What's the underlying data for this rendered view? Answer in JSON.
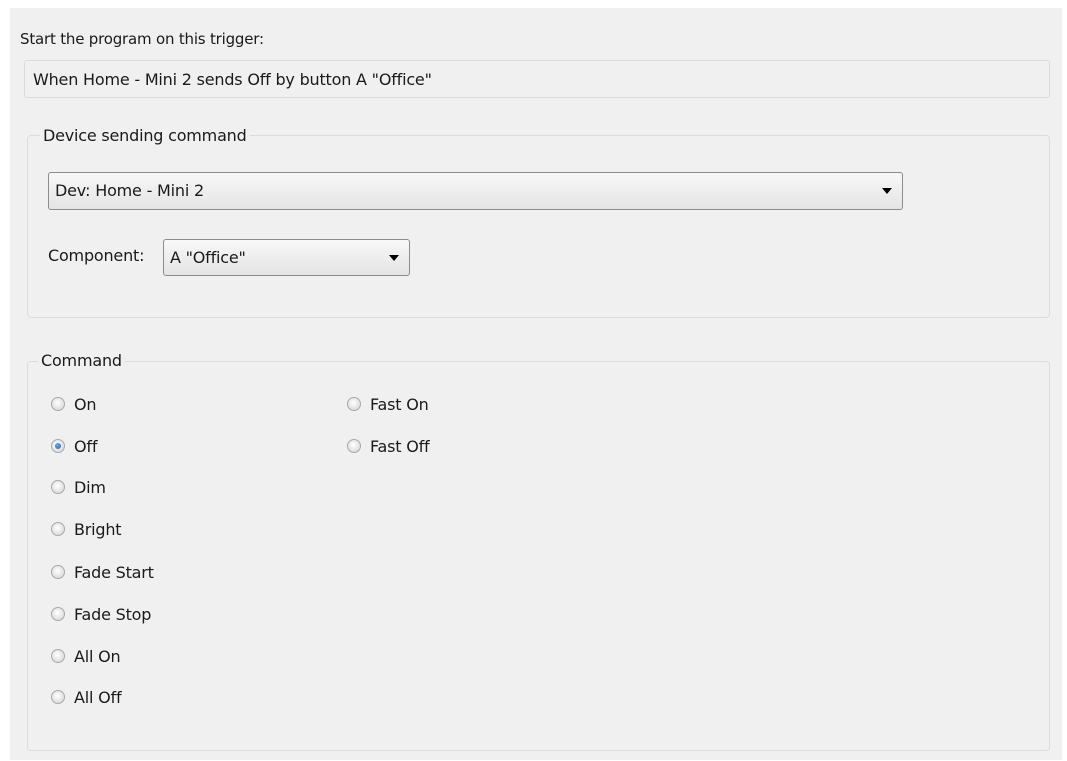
{
  "trigger": {
    "label": "Start the program on this trigger:",
    "description": "When Home - Mini 2 sends Off by button A \"Office\""
  },
  "device_group": {
    "legend": "Device sending command",
    "device_select": {
      "value": "Dev: Home - Mini 2"
    },
    "component_label": "Component:",
    "component_select": {
      "value": "A \"Office\""
    }
  },
  "command_group": {
    "legend": "Command",
    "options": [
      {
        "label": "On",
        "checked": false
      },
      {
        "label": "Off",
        "checked": true
      },
      {
        "label": "Dim",
        "checked": false
      },
      {
        "label": "Bright",
        "checked": false
      },
      {
        "label": "Fade Start",
        "checked": false
      },
      {
        "label": "Fade Stop",
        "checked": false
      },
      {
        "label": "All On",
        "checked": false
      },
      {
        "label": "All Off",
        "checked": false
      },
      {
        "label": "Fast On",
        "checked": false
      },
      {
        "label": "Fast Off",
        "checked": false
      }
    ]
  }
}
